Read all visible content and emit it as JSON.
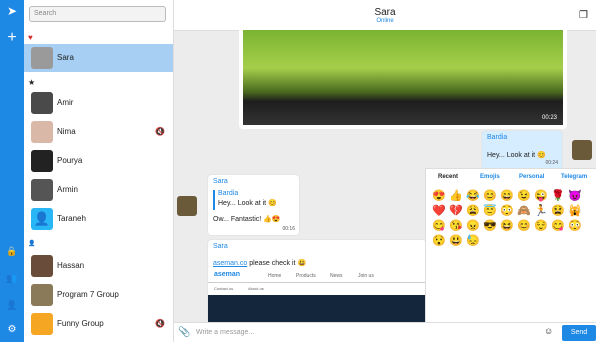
{
  "sidebar": {
    "search_placeholder": "Search",
    "favorites_mark": "♥",
    "starred_mark": "★",
    "people_mark": "👤",
    "chats": [
      {
        "name": "Sara"
      },
      {
        "name": "Amir"
      },
      {
        "name": "Nima"
      },
      {
        "name": "Pourya"
      },
      {
        "name": "Armin"
      },
      {
        "name": "Taraneh"
      },
      {
        "name": "Hassan"
      },
      {
        "name": "Program 7 Group"
      },
      {
        "name": "Funny Group"
      }
    ]
  },
  "header": {
    "name": "Sara",
    "status": "Online"
  },
  "messages": {
    "image_time": "00:23",
    "out_name": "Bardia",
    "out_text": "Hey... Look at it 😊",
    "out_time": "00:24",
    "in_name": "Sara",
    "in_quote_name": "Bardia",
    "in_quote_text": "Hey... Look at it 😊",
    "in_text": "Ow... Fantastic! 👍😍",
    "in_time": "00:16",
    "link_name": "Sara",
    "link_url": "aseman.co",
    "link_text": " please check it 😃",
    "web_brand": "aseman",
    "web_nav": [
      "Home",
      "Products",
      "News",
      "Join us"
    ],
    "web_nav2": [
      "Contact us",
      "About us"
    ]
  },
  "emoji": {
    "tabs": [
      "Recent",
      "Emojis",
      "Personal",
      "Telegram"
    ],
    "items": [
      "😍",
      "👍",
      "😂",
      "😊",
      "😄",
      "😉",
      "😜",
      "🌹",
      "😈",
      "❤️",
      "💔",
      "😩",
      "😇",
      "😳",
      "🙈",
      "🏃",
      "😫",
      "🙀",
      "😋",
      "😘",
      "😠",
      "😎",
      "😆",
      "😊",
      "😌",
      "😋",
      "😳",
      "😯",
      "😃",
      "😓"
    ]
  },
  "input": {
    "placeholder": "Write a message...",
    "send": "Send"
  }
}
